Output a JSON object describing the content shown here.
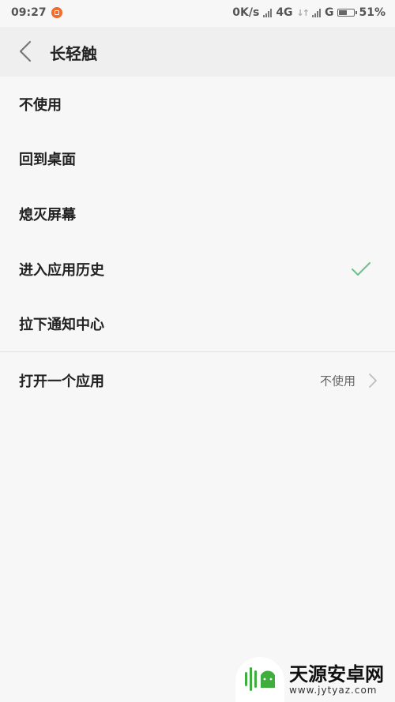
{
  "status_bar": {
    "time": "09:27",
    "net_speed": "0K/s",
    "network_1": "4G",
    "network_2": "G",
    "battery": "51%"
  },
  "header": {
    "title": "长轻触"
  },
  "options": [
    {
      "label": "不使用",
      "selected": false
    },
    {
      "label": "回到桌面",
      "selected": false
    },
    {
      "label": "熄灭屏幕",
      "selected": false
    },
    {
      "label": "进入应用历史",
      "selected": true
    },
    {
      "label": "拉下通知中心",
      "selected": false
    }
  ],
  "open_app": {
    "label": "打开一个应用",
    "value": "不使用"
  },
  "watermark": {
    "name": "天源安卓网",
    "url": "www.jytyaz.com"
  },
  "colors": {
    "check": "#6cc08b",
    "watermark_green": "#3fae3f"
  }
}
